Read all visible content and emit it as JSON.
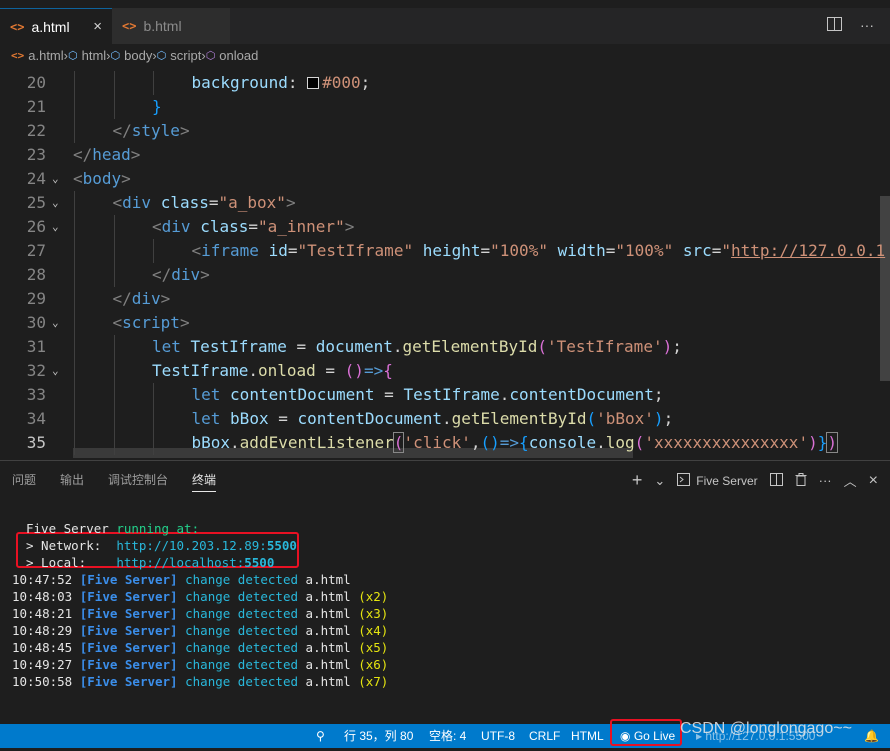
{
  "tabs": [
    {
      "label": "a.html",
      "icon": "html-file-icon",
      "active": true
    },
    {
      "label": "b.html",
      "icon": "html-file-icon",
      "active": false
    }
  ],
  "tab_icon_glyph": "<>",
  "close_glyph": "×",
  "breadcrumb": [
    {
      "label": "a.html",
      "icon": "html-file-icon"
    },
    {
      "label": "html",
      "icon": "element-icon"
    },
    {
      "label": "body",
      "icon": "element-icon"
    },
    {
      "label": "script",
      "icon": "element-icon"
    },
    {
      "label": "onload",
      "icon": "method-icon"
    }
  ],
  "editor": {
    "current_line": 35,
    "lines": [
      {
        "n": 20,
        "fold": false,
        "ind": 3,
        "t": [
          [
            "t-prop",
            "background"
          ],
          [
            "t-txt",
            ": "
          ],
          [
            "swatch",
            ""
          ],
          [
            "t-num",
            "#000"
          ],
          [
            "t-txt",
            ";"
          ]
        ]
      },
      {
        "n": 21,
        "fold": false,
        "ind": 2,
        "t": [
          [
            "t-brace",
            "}"
          ]
        ]
      },
      {
        "n": 22,
        "fold": false,
        "ind": 1,
        "t": [
          [
            "t-br",
            "</"
          ],
          [
            "t-tag",
            "style"
          ],
          [
            "t-br",
            ">"
          ]
        ]
      },
      {
        "n": 23,
        "fold": false,
        "ind": 0,
        "t": [
          [
            "t-br",
            "</"
          ],
          [
            "t-tag",
            "head"
          ],
          [
            "t-br",
            ">"
          ]
        ]
      },
      {
        "n": 24,
        "fold": true,
        "ind": 0,
        "t": [
          [
            "t-br",
            "<"
          ],
          [
            "t-tag",
            "body"
          ],
          [
            "t-br",
            ">"
          ]
        ]
      },
      {
        "n": 25,
        "fold": true,
        "ind": 1,
        "t": [
          [
            "t-br",
            "<"
          ],
          [
            "t-tag",
            "div"
          ],
          [
            "t-txt",
            " "
          ],
          [
            "t-attr",
            "class"
          ],
          [
            "t-txt",
            "="
          ],
          [
            "t-str",
            "\"a_box\""
          ],
          [
            "t-br",
            ">"
          ]
        ]
      },
      {
        "n": 26,
        "fold": true,
        "ind": 2,
        "t": [
          [
            "t-br",
            "<"
          ],
          [
            "t-tag",
            "div"
          ],
          [
            "t-txt",
            " "
          ],
          [
            "t-attr",
            "class"
          ],
          [
            "t-txt",
            "="
          ],
          [
            "t-str",
            "\"a_inner\""
          ],
          [
            "t-br",
            ">"
          ]
        ]
      },
      {
        "n": 27,
        "fold": false,
        "ind": 3,
        "t": [
          [
            "t-br",
            "<"
          ],
          [
            "t-tag",
            "iframe"
          ],
          [
            "t-txt",
            " "
          ],
          [
            "t-attr",
            "id"
          ],
          [
            "t-txt",
            "="
          ],
          [
            "t-str",
            "\"TestIframe\""
          ],
          [
            "t-txt",
            " "
          ],
          [
            "t-attr",
            "height"
          ],
          [
            "t-txt",
            "="
          ],
          [
            "t-str",
            "\"100%\""
          ],
          [
            "t-txt",
            " "
          ],
          [
            "t-attr",
            "width"
          ],
          [
            "t-txt",
            "="
          ],
          [
            "t-str",
            "\"100%\""
          ],
          [
            "t-txt",
            " "
          ],
          [
            "t-attr",
            "src"
          ],
          [
            "t-txt",
            "="
          ],
          [
            "t-str",
            "\""
          ],
          [
            "t-link",
            "http://127.0.0.1"
          ]
        ]
      },
      {
        "n": 28,
        "fold": false,
        "ind": 2,
        "t": [
          [
            "t-br",
            "</"
          ],
          [
            "t-tag",
            "div"
          ],
          [
            "t-br",
            ">"
          ]
        ]
      },
      {
        "n": 29,
        "fold": false,
        "ind": 1,
        "t": [
          [
            "t-br",
            "</"
          ],
          [
            "t-tag",
            "div"
          ],
          [
            "t-br",
            ">"
          ]
        ]
      },
      {
        "n": 30,
        "fold": true,
        "ind": 1,
        "t": [
          [
            "t-br",
            "<"
          ],
          [
            "t-tag",
            "script"
          ],
          [
            "t-br",
            ">"
          ]
        ]
      },
      {
        "n": 31,
        "fold": false,
        "ind": 2,
        "t": [
          [
            "t-kw",
            "let"
          ],
          [
            "t-txt",
            " "
          ],
          [
            "t-var",
            "TestIframe"
          ],
          [
            "t-txt",
            " = "
          ],
          [
            "t-var",
            "document"
          ],
          [
            "t-txt",
            "."
          ],
          [
            "t-fn",
            "getElementById"
          ],
          [
            "t-paren",
            "("
          ],
          [
            "t-str",
            "'TestIframe'"
          ],
          [
            "t-paren",
            ")"
          ],
          [
            "t-txt",
            ";"
          ]
        ]
      },
      {
        "n": 32,
        "fold": true,
        "ind": 2,
        "t": [
          [
            "t-var",
            "TestIframe"
          ],
          [
            "t-txt",
            "."
          ],
          [
            "t-fn",
            "onload"
          ],
          [
            "t-txt",
            " = "
          ],
          [
            "t-paren",
            "()"
          ],
          [
            "t-kw",
            "=>"
          ],
          [
            "t-paren",
            "{"
          ]
        ]
      },
      {
        "n": 33,
        "fold": false,
        "ind": 3,
        "t": [
          [
            "t-kw",
            "let"
          ],
          [
            "t-txt",
            " "
          ],
          [
            "t-var",
            "contentDocument"
          ],
          [
            "t-txt",
            " = "
          ],
          [
            "t-var",
            "TestIframe"
          ],
          [
            "t-txt",
            "."
          ],
          [
            "t-var",
            "contentDocument"
          ],
          [
            "t-txt",
            ";"
          ]
        ]
      },
      {
        "n": 34,
        "fold": false,
        "ind": 3,
        "t": [
          [
            "t-kw",
            "let"
          ],
          [
            "t-txt",
            " "
          ],
          [
            "t-var",
            "bBox"
          ],
          [
            "t-txt",
            " = "
          ],
          [
            "t-var",
            "contentDocument"
          ],
          [
            "t-txt",
            "."
          ],
          [
            "t-fn",
            "getElementById"
          ],
          [
            "t-brace",
            "("
          ],
          [
            "t-str",
            "'bBox'"
          ],
          [
            "t-brace",
            ")"
          ],
          [
            "t-txt",
            ";"
          ]
        ]
      },
      {
        "n": 35,
        "fold": false,
        "ind": 3,
        "t": [
          [
            "t-var",
            "bBox"
          ],
          [
            "t-txt",
            "."
          ],
          [
            "t-fn",
            "addEventListener"
          ],
          [
            "t-hl",
            "("
          ],
          [
            "t-str",
            "'click'"
          ],
          [
            "t-txt",
            ","
          ],
          [
            "t-brace",
            "()"
          ],
          [
            "t-kw",
            "=>"
          ],
          [
            "t-brace",
            "{"
          ],
          [
            "t-var",
            "console"
          ],
          [
            "t-txt",
            "."
          ],
          [
            "t-fn",
            "log"
          ],
          [
            "t-paren",
            "("
          ],
          [
            "t-str",
            "'xxxxxxxxxxxxxxx'"
          ],
          [
            "t-paren",
            ")"
          ],
          [
            "t-brace",
            "}"
          ],
          [
            "t-hl",
            ")"
          ]
        ]
      }
    ]
  },
  "panel": {
    "tabs": [
      "问题",
      "输出",
      "调试控制台",
      "终端"
    ],
    "active_tab": "终端",
    "add_glyph": "+",
    "dropdown_glyph": "⌄",
    "terminal_name": "Five Server",
    "split_glyph": "◫",
    "trash_glyph": "🗑",
    "more_glyph": "···",
    "maximize_glyph": "︿",
    "close_glyph": "×"
  },
  "terminal": {
    "header": [
      [
        "tw",
        "Five Server "
      ],
      [
        "tg",
        "running at:"
      ]
    ],
    "network": [
      [
        "tw",
        "> Network:  "
      ],
      [
        "tt",
        "http://10.203.12.89:"
      ],
      [
        "tt tbold",
        "5500"
      ]
    ],
    "local": [
      [
        "tw",
        "> Local:    "
      ],
      [
        "tt",
        "http://localhost:"
      ],
      [
        "tt tbold",
        "5500"
      ]
    ],
    "logs": [
      {
        "time": "10:47:52",
        "tag": "[Five Server]",
        "msg": "change detected",
        "file": "a.html",
        "count": ""
      },
      {
        "time": "10:48:03",
        "tag": "[Five Server]",
        "msg": "change detected",
        "file": "a.html",
        "count": "(x2)"
      },
      {
        "time": "10:48:21",
        "tag": "[Five Server]",
        "msg": "change detected",
        "file": "a.html",
        "count": "(x3)"
      },
      {
        "time": "10:48:29",
        "tag": "[Five Server]",
        "msg": "change detected",
        "file": "a.html",
        "count": "(x4)"
      },
      {
        "time": "10:48:45",
        "tag": "[Five Server]",
        "msg": "change detected",
        "file": "a.html",
        "count": "(x5)"
      },
      {
        "time": "10:49:27",
        "tag": "[Five Server]",
        "msg": "change detected",
        "file": "a.html",
        "count": "(x6)"
      },
      {
        "time": "10:50:58",
        "tag": "[Five Server]",
        "msg": "change detected",
        "file": "a.html",
        "count": "(x7)"
      }
    ]
  },
  "status": {
    "position": "行 35，列 80",
    "spaces": "空格: 4",
    "encoding": "UTF-8",
    "eol": "CRLF",
    "language": "HTML",
    "go_live": "Go Live",
    "live_url": "http://127.0.0.1:5500",
    "location_glyph": "⚲",
    "broadcast_glyph": "◉",
    "play_glyph": "▸",
    "bell_glyph": "🔔"
  },
  "watermark": "CSDN @longlongago~~",
  "colors": {
    "accent": "#007acc",
    "highlight_box": "#e81123",
    "editor_bg": "#1e1e1e"
  }
}
